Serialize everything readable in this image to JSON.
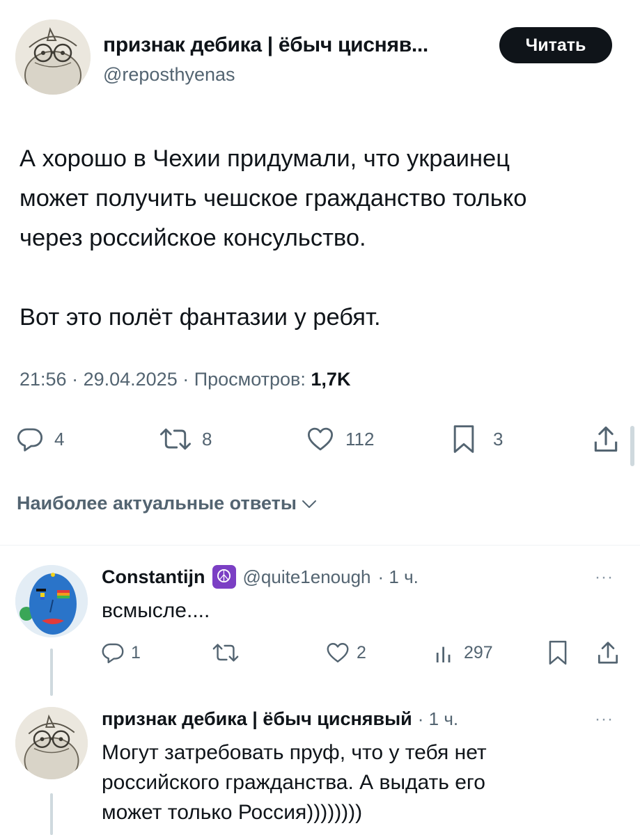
{
  "main_tweet": {
    "author_name": "признак дебика | ёбыч цисняв...",
    "author_handle": "@reposthyenas",
    "follow_label": "Читать",
    "text": "А хорошо в Чехии придумали, что украинец\nможет получить чешское гражданство только\nчерез российское консульство.\n\nВот это полёт фантазии у ребят.",
    "time": "21:56",
    "date": "29.04.2025",
    "views_label": "Просмотров:",
    "views_count": "1,7K",
    "separator": " · ",
    "actions": {
      "replies": "4",
      "reposts": "8",
      "likes": "112",
      "bookmarks": "3"
    }
  },
  "replies_sort": {
    "label": "Наиболее актуальные ответы"
  },
  "replies": [
    {
      "author_name": "Constantijn",
      "badge_emoji": "☮",
      "author_handle": "@quite1enough",
      "time": "· 1 ч.",
      "text": "всмысле....",
      "actions": {
        "replies": "1",
        "reposts": "",
        "likes": "2",
        "views": "297"
      }
    },
    {
      "author_name": "признак дебика | ёбыч циснявый",
      "time": "· 1 ч.",
      "text": "Могут затребовать пруф, что у тебя нет\nроссийского гражданства. А выдать его\nможет только Россия))))))))"
    }
  ],
  "more_label": "···",
  "colors": {
    "text_primary": "#0f1419",
    "text_secondary": "#536471",
    "follow_button_bg": "#0f1419",
    "divider": "#eff3f4"
  }
}
